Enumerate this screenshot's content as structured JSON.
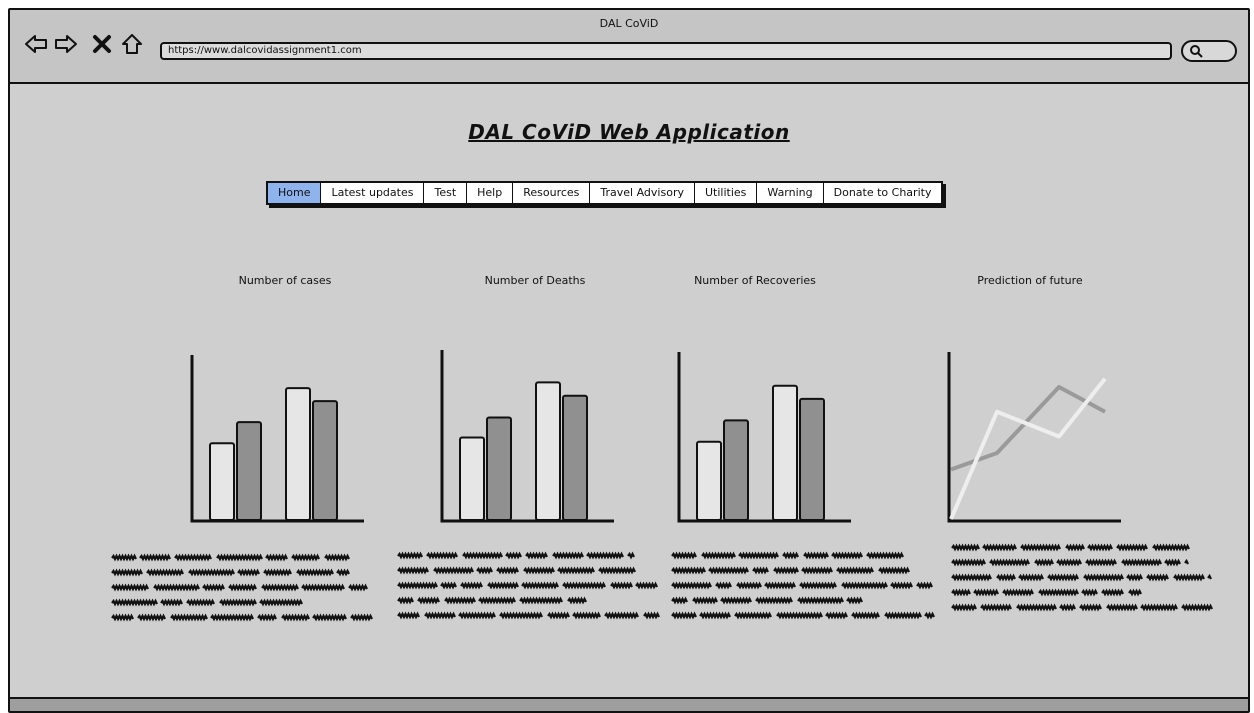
{
  "window": {
    "title": "DAL CoViD",
    "url": "https://www.dalcovidassignment1.com"
  },
  "toolbar": {
    "back_icon": "arrow-left-icon",
    "forward_icon": "arrow-right-icon",
    "stop_icon": "close-icon",
    "home_icon": "home-icon",
    "search_icon": "search-icon"
  },
  "page": {
    "title": "DAL CoViD Web Application "
  },
  "menu": {
    "items": [
      {
        "label": "Home",
        "active": true
      },
      {
        "label": "Latest updates",
        "active": false
      },
      {
        "label": "Test",
        "active": false
      },
      {
        "label": "Help",
        "active": false
      },
      {
        "label": "Resources",
        "active": false
      },
      {
        "label": "Travel Advisory",
        "active": false
      },
      {
        "label": "Utilities",
        "active": false
      },
      {
        "label": "Warning",
        "active": false
      },
      {
        "label": "Donate to Charity",
        "active": false
      }
    ],
    "active_color": "#8fb3ec"
  },
  "cards": [
    {
      "label": "Number of cases"
    },
    {
      "label": "Number of Deaths"
    },
    {
      "label": "Number of Recoveries"
    },
    {
      "label": "Prediction of future"
    }
  ],
  "chart_data": [
    {
      "type": "bar",
      "title": "",
      "series": [
        {
          "values": [
            48,
            61,
            82,
            74
          ]
        }
      ],
      "categories": [
        "",
        "",
        "",
        ""
      ]
    },
    {
      "type": "bar",
      "title": "",
      "series": [
        {
          "values": [
            50,
            62,
            83,
            75
          ]
        }
      ],
      "categories": [
        "",
        "",
        "",
        ""
      ]
    },
    {
      "type": "bar",
      "title": "",
      "series": [
        {
          "values": [
            48,
            61,
            82,
            74
          ]
        }
      ],
      "categories": [
        "",
        "",
        "",
        ""
      ]
    },
    {
      "type": "line",
      "title": "",
      "series": [
        {
          "values": [
            30,
            40,
            80,
            65
          ],
          "color": "#9a9a9a"
        },
        {
          "values": [
            0,
            65,
            50,
            85
          ],
          "color": "#eeeeee"
        }
      ]
    }
  ],
  "colors": {
    "light_bar": "#e6e6e6",
    "dark_bar": "#909090",
    "window_bg": "#cfcfcf"
  }
}
